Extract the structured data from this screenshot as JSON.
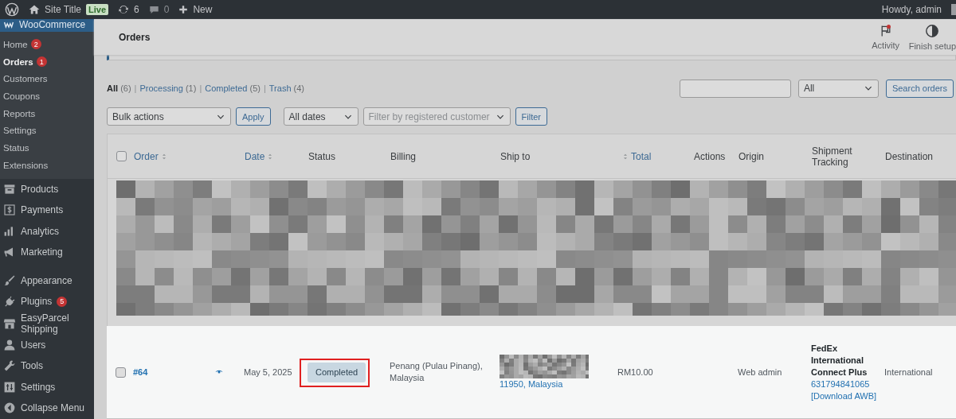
{
  "admin_bar": {
    "site_title": "Site Title",
    "live_badge": "Live",
    "updates_count": "6",
    "comments_count": "0",
    "new_label": "New",
    "greeting": "Howdy, admin"
  },
  "sidebar": {
    "header": {
      "label": "WooCommerce",
      "selected": true
    },
    "submenu": [
      {
        "label": "Home",
        "badge": "2",
        "selected": false
      },
      {
        "label": "Orders",
        "badge": "1",
        "selected": true
      },
      {
        "label": "Customers",
        "selected": false
      },
      {
        "label": "Coupons",
        "selected": false
      },
      {
        "label": "Reports",
        "selected": false
      },
      {
        "label": "Settings",
        "selected": false
      },
      {
        "label": "Status",
        "selected": false
      },
      {
        "label": "Extensions",
        "selected": false
      }
    ],
    "menu_groups": [
      [
        {
          "label": "Products",
          "selected": false
        },
        {
          "label": "Payments",
          "selected": false
        },
        {
          "label": "Analytics",
          "selected": false
        },
        {
          "label": "Marketing",
          "selected": false
        }
      ],
      [
        {
          "label": "Appearance",
          "selected": false
        },
        {
          "label": "Plugins",
          "badge": "5",
          "selected": false
        },
        {
          "label": "EasyParcel Shipping",
          "selected": false
        },
        {
          "label": "Users",
          "selected": false
        },
        {
          "label": "Tools",
          "selected": false
        },
        {
          "label": "Settings",
          "selected": false
        }
      ]
    ],
    "collapse": "Collapse Menu"
  },
  "page_header": {
    "title": "Orders",
    "actions": [
      {
        "label": "Activity",
        "alert": true
      },
      {
        "label": "Finish setup",
        "alert": false
      }
    ]
  },
  "views": [
    {
      "label": "All",
      "count": "(6)",
      "selected": true
    },
    {
      "separator": "|",
      "label": "Processing",
      "count": "(1)",
      "selected": false
    },
    {
      "separator": "|",
      "label": "Completed",
      "count": "(5)",
      "selected": false
    },
    {
      "separator": "|",
      "label": "Trash",
      "count": "(4)",
      "selected": false
    }
  ],
  "search": {
    "type_select": "All",
    "button": "Search orders"
  },
  "filters": {
    "bulk_actions": "Bulk actions",
    "apply": "Apply",
    "dates": "All dates",
    "customer_placeholder": "Filter by registered customer",
    "filter": "Filter"
  },
  "table": {
    "select_all_checked": false,
    "columns": [
      {
        "label": "Order",
        "sortable": true,
        "icon_first": false
      },
      {
        "label": "Date",
        "sortable": true,
        "icon_first": false
      },
      {
        "label": "Status"
      },
      {
        "label": "Billing"
      },
      {
        "label": "Ship to"
      },
      {
        "label": "Total",
        "sortable": true,
        "icon_first": true
      },
      {
        "label": "Actions"
      },
      {
        "label": "Origin"
      },
      {
        "label": "Shipment Tracking"
      },
      {
        "label": "Destination"
      }
    ],
    "rows": [
      {
        "kind": "redacted"
      },
      {
        "kind": "order",
        "checked": false,
        "order": "#64",
        "date": "May 5, 2025",
        "status": "Completed",
        "highlighted": true,
        "billing": "Penang (Pulau Pinang), Malaysia",
        "ship_to": "11950, Malaysia",
        "total": "RM10.00",
        "origin": "Web admin",
        "carrier": "FedEx International Connect Plus",
        "tracking": "631794841065",
        "awb": "[Download AWB]",
        "destination": "International"
      }
    ]
  }
}
